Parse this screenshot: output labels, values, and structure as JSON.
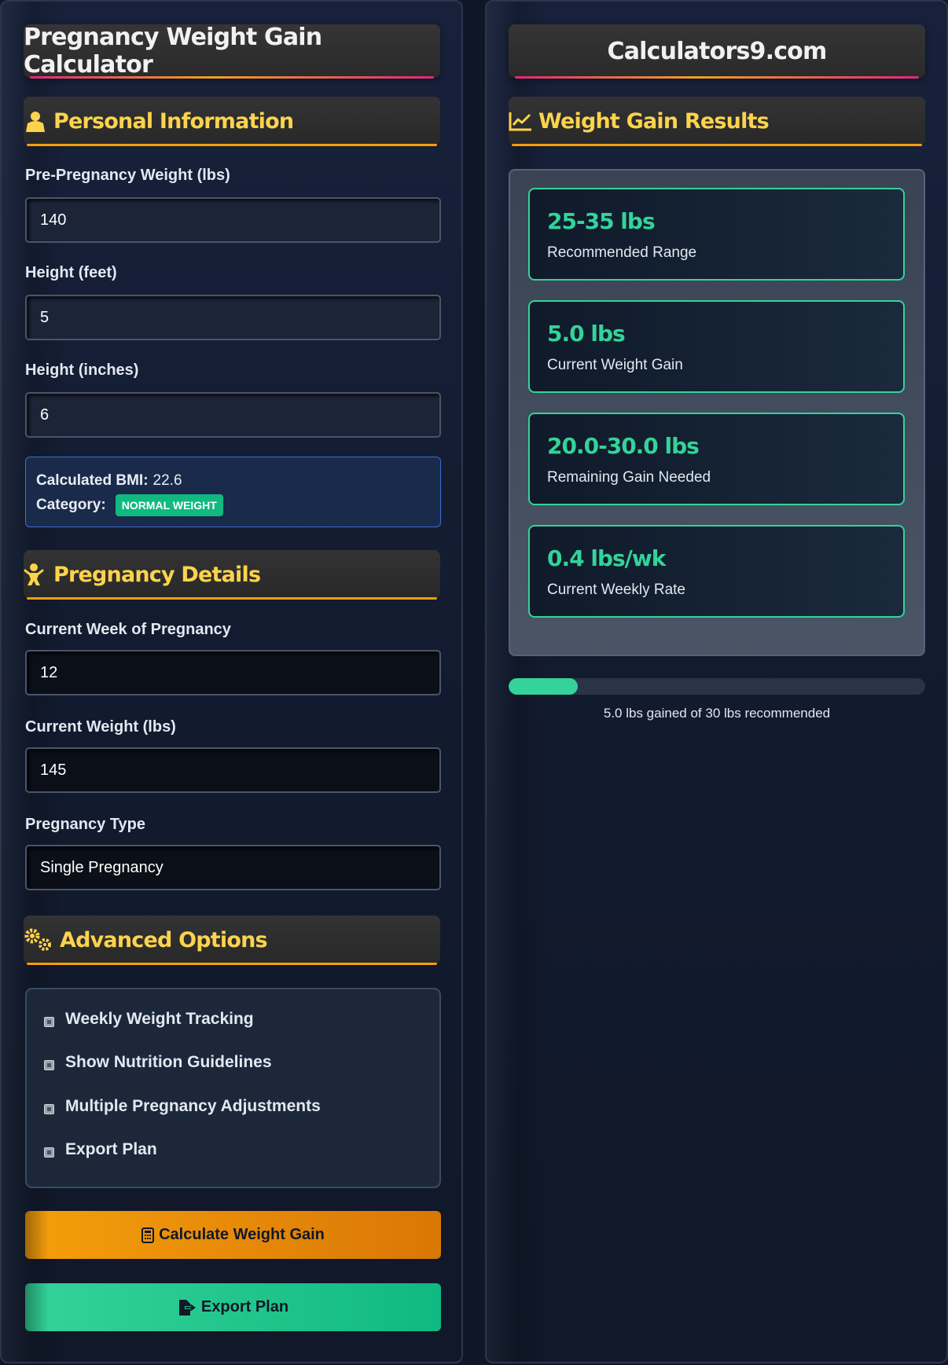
{
  "left": {
    "title": "Pregnancy Weight Gain Calculator",
    "personal_section": "Personal Information",
    "fields": {
      "pre_weight_label": "Pre-Pregnancy Weight (lbs)",
      "pre_weight_value": "140",
      "height_feet_label": "Height (feet)",
      "height_feet_value": "5",
      "height_inches_label": "Height (inches)",
      "height_inches_value": "6"
    },
    "bmi": {
      "bmi_label": "Calculated BMI:",
      "bmi_value": "22.6",
      "category_label": "Category:",
      "category_value": "NORMAL WEIGHT"
    },
    "pregnancy_section": "Pregnancy Details",
    "pregnancy": {
      "week_label": "Current Week of Pregnancy",
      "week_value": "12",
      "current_weight_label": "Current Weight (lbs)",
      "current_weight_value": "145",
      "type_label": "Pregnancy Type",
      "type_value": "Single Pregnancy"
    },
    "advanced_section": "Advanced Options",
    "options": [
      "Weekly Weight Tracking",
      "Show Nutrition Guidelines",
      "Multiple Pregnancy Adjustments",
      "Export Plan"
    ],
    "calculate_button": "Calculate Weight Gain",
    "export_button": "Export Plan"
  },
  "right": {
    "title": "Calculators9.com",
    "results_section": "Weight Gain Results",
    "results": [
      {
        "value": "25-35 lbs",
        "label": "Recommended Range"
      },
      {
        "value": "5.0 lbs",
        "label": "Current Weight Gain"
      },
      {
        "value": "20.0-30.0 lbs",
        "label": "Remaining Gain Needed"
      },
      {
        "value": "0.4 lbs/wk",
        "label": "Current Weekly Rate"
      }
    ],
    "progress": {
      "fraction": 0.1667,
      "text": "5.0 lbs gained of 30 lbs recommended"
    }
  },
  "colors": {
    "accent_gold": "#fcd34d",
    "accent_green": "#34d399",
    "accent_orange": "#f59e0b",
    "accent_pink": "#e0287a"
  },
  "icons": {
    "personal": "user-icon",
    "pregnancy": "baby-icon",
    "advanced": "gears-icon",
    "results": "line-chart-icon",
    "calculate": "calculator-icon",
    "export": "file-export-icon"
  }
}
